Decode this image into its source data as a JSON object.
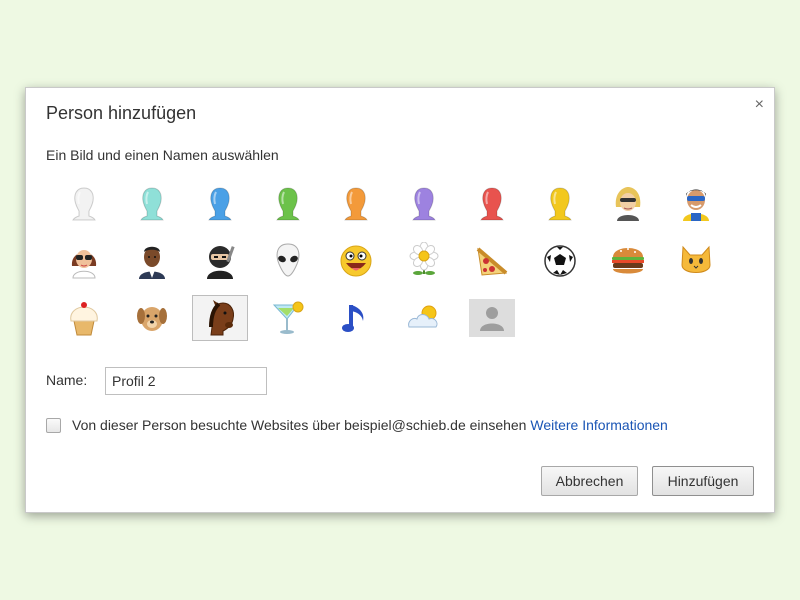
{
  "dialog": {
    "title": "Person hinzufügen",
    "close_glyph": "×",
    "subtitle": "Ein Bild und einen Namen auswählen"
  },
  "avatars": [
    {
      "icon": "white-silhouette-icon",
      "color": "#f2f2f2"
    },
    {
      "icon": "teal-silhouette-icon",
      "color": "#8fe0d8"
    },
    {
      "icon": "blue-silhouette-icon",
      "color": "#4aa0e6"
    },
    {
      "icon": "green-silhouette-icon",
      "color": "#6cc24a"
    },
    {
      "icon": "orange-silhouette-icon",
      "color": "#f39a3a"
    },
    {
      "icon": "purple-silhouette-icon",
      "color": "#9d82e0"
    },
    {
      "icon": "red-silhouette-icon",
      "color": "#e8534e"
    },
    {
      "icon": "yellow-silhouette-icon",
      "color": "#f2c81e"
    },
    {
      "icon": "blonde-businesswoman-icon"
    },
    {
      "icon": "superhero-icon"
    },
    {
      "icon": "woman-sunglasses-icon"
    },
    {
      "icon": "businessman-icon"
    },
    {
      "icon": "ninja-icon"
    },
    {
      "icon": "alien-icon"
    },
    {
      "icon": "smiley-icon"
    },
    {
      "icon": "flower-icon"
    },
    {
      "icon": "pizza-icon"
    },
    {
      "icon": "soccer-ball-icon"
    },
    {
      "icon": "burger-icon"
    },
    {
      "icon": "cat-icon"
    },
    {
      "icon": "cupcake-icon"
    },
    {
      "icon": "dog-icon"
    },
    {
      "icon": "horse-icon",
      "selected": true
    },
    {
      "icon": "cocktail-icon"
    },
    {
      "icon": "music-note-icon"
    },
    {
      "icon": "sun-cloud-icon"
    },
    {
      "icon": "placeholder-person-icon"
    }
  ],
  "form": {
    "name_label": "Name:",
    "name_value": "Profil 2",
    "checkbox_checked": false,
    "checkbox_text": "Von dieser Person besuchte Websites über beispiel@schieb.de einsehen",
    "link_text": "Weitere Informationen"
  },
  "buttons": {
    "cancel": "Abbrechen",
    "add": "Hinzufügen"
  }
}
